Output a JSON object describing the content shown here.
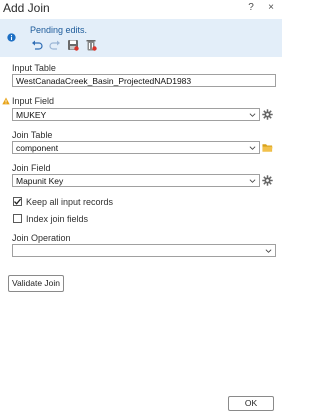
{
  "window": {
    "title": "Add Join",
    "help_label": "?",
    "close_label": "×"
  },
  "notice": {
    "message": "Pending edits.",
    "icons": [
      "info-icon",
      "undo-icon",
      "redo-icon",
      "save-edits-icon",
      "discard-edits-icon"
    ]
  },
  "form": {
    "input_table_label": "Input Table",
    "input_table_value": "WestCanadaCreek_Basin_ProjectedNAD1983",
    "input_field_label": "Input Field",
    "input_field_value": "MUKEY",
    "join_table_label": "Join Table",
    "join_table_value": "component",
    "join_field_label": "Join Field",
    "join_field_value": "Mapunit Key",
    "keep_all_label": "Keep all input records",
    "keep_all_checked": true,
    "index_join_label": "Index join fields",
    "index_join_checked": false,
    "join_operation_label": "Join Operation",
    "join_operation_value": ""
  },
  "buttons": {
    "validate_label": "Validate Join",
    "ok_label": "OK"
  },
  "colors": {
    "notice_bg": "#e3eef9",
    "accent": "#1d5b9a",
    "warning": "#e8a317"
  }
}
